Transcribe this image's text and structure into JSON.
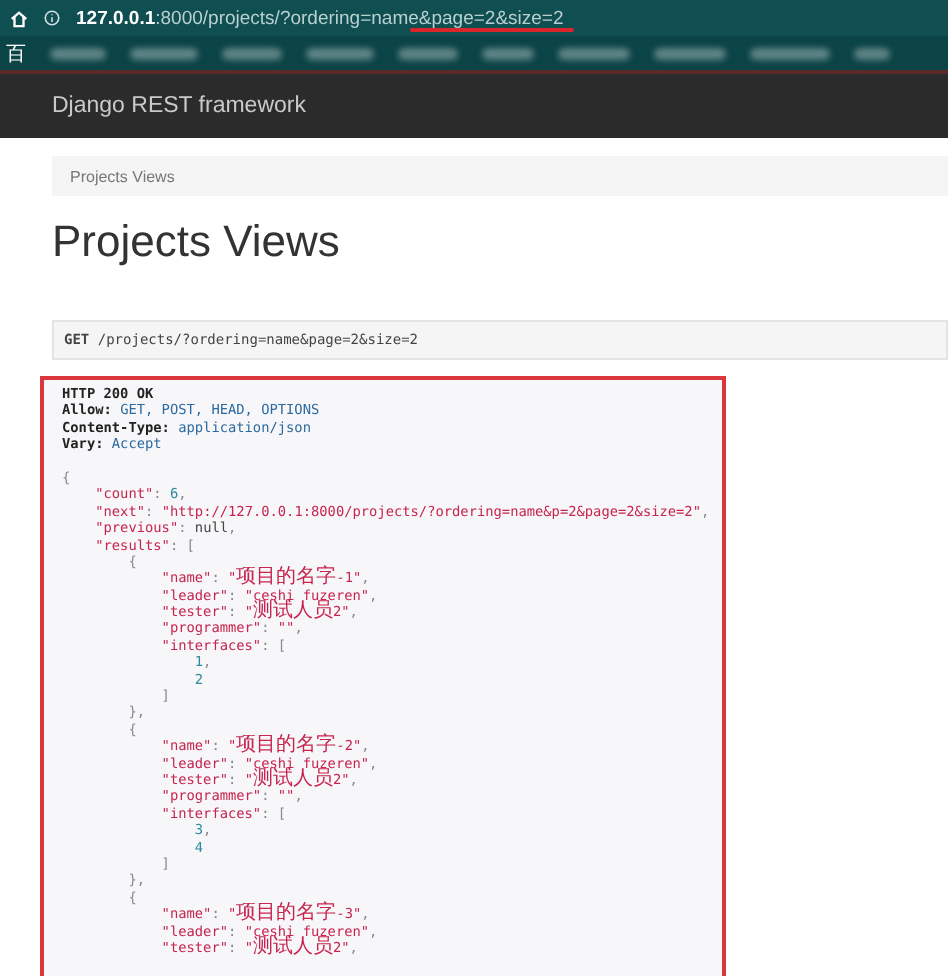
{
  "browser": {
    "url_host": "127.0.0.1",
    "url_rest": ":8000/projects/?ordering=name&page=2&size=2",
    "bookmark": "百"
  },
  "navbar": {
    "brand": "Django REST framework"
  },
  "breadcrumb": [
    {
      "label": "Projects Views",
      "selected": true
    }
  ],
  "page_title": "Projects Views",
  "request": {
    "method": "GET",
    "path": "/projects/?ordering=name&page=2&size=2"
  },
  "response": {
    "status": "HTTP 200 OK",
    "headers": [
      {
        "name": "Allow:",
        "value": "GET, POST, HEAD, OPTIONS"
      },
      {
        "name": "Content-Type:",
        "value": "application/json"
      },
      {
        "name": "Vary:",
        "value": "Accept"
      }
    ],
    "body": [
      "{",
      "    \"count\": 6,",
      "    \"next\": \"http://127.0.0.1:8000/projects/?ordering=name&p=2&page=2&size=2\",",
      "    \"previous\": null,",
      "    \"results\": [",
      "        {",
      "            \"name\": \"项目的名字-1\",",
      "            \"leader\": \"ceshi fuzeren\",",
      "            \"tester\": \"测试人员2\",",
      "            \"programmer\": \"\",",
      "            \"interfaces\": [",
      "                1,",
      "                2",
      "            ]",
      "        },",
      "        {",
      "            \"name\": \"项目的名字-2\",",
      "            \"leader\": \"ceshi fuzeren\",",
      "            \"tester\": \"测试人员2\",",
      "            \"programmer\": \"\",",
      "            \"interfaces\": [",
      "                3,",
      "                4",
      "            ]",
      "        },",
      "        {",
      "            \"name\": \"项目的名字-3\",",
      "            \"leader\": \"ceshi fuzeren\",",
      "            \"tester\": \"测试人员2\","
    ]
  }
}
